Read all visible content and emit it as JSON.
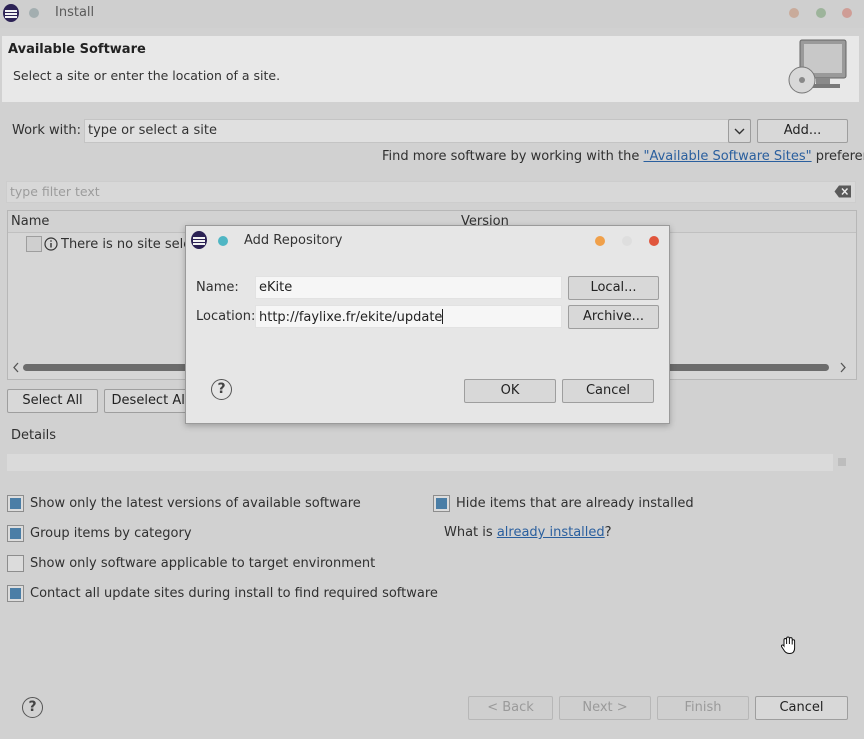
{
  "window": {
    "title": "Install"
  },
  "header": {
    "title": "Available Software",
    "subtitle": "Select a site or enter the location of a site."
  },
  "work_with": {
    "label": "Work with:",
    "placeholder": "type or select a site",
    "add_button": "Add..."
  },
  "find_more": {
    "prefix": "Find more software by working with the ",
    "link": "\"Available Software Sites\"",
    "suffix": " preferences."
  },
  "filter": {
    "placeholder": "type filter text"
  },
  "tree": {
    "columns": [
      "Name",
      "Version"
    ],
    "message": "There is no site select"
  },
  "buttons": {
    "select_all": "Select All",
    "deselect_all": "Deselect All"
  },
  "details": {
    "label": "Details"
  },
  "options": {
    "latest_versions": {
      "label": "Show only the latest versions of available software",
      "checked": true
    },
    "group_by_category": {
      "label": "Group items by category",
      "checked": true
    },
    "target_env": {
      "label": "Show only software applicable to target environment",
      "checked": false
    },
    "contact_sites": {
      "label": "Contact all update sites during install to find required software",
      "checked": true
    },
    "hide_installed": {
      "label": "Hide items that are already installed",
      "checked": true
    },
    "what_is": {
      "prefix": "What is ",
      "link": "already installed",
      "suffix": "?"
    }
  },
  "footer": {
    "back": "< Back",
    "next": "Next >",
    "finish": "Finish",
    "cancel": "Cancel"
  },
  "dialog": {
    "title": "Add Repository",
    "name_label": "Name:",
    "name_value": "eKite",
    "location_label": "Location:",
    "location_value": "http://faylixe.fr/ekite/update",
    "local_button": "Local...",
    "archive_button": "Archive...",
    "ok_button": "OK",
    "cancel_button": "Cancel"
  },
  "colors": {
    "accent": "#4b7ea6",
    "link": "#2a5f9e",
    "dot_orange": "#f0a04a",
    "dot_red": "#e0553c",
    "dot_teal": "#4fb6c4"
  }
}
